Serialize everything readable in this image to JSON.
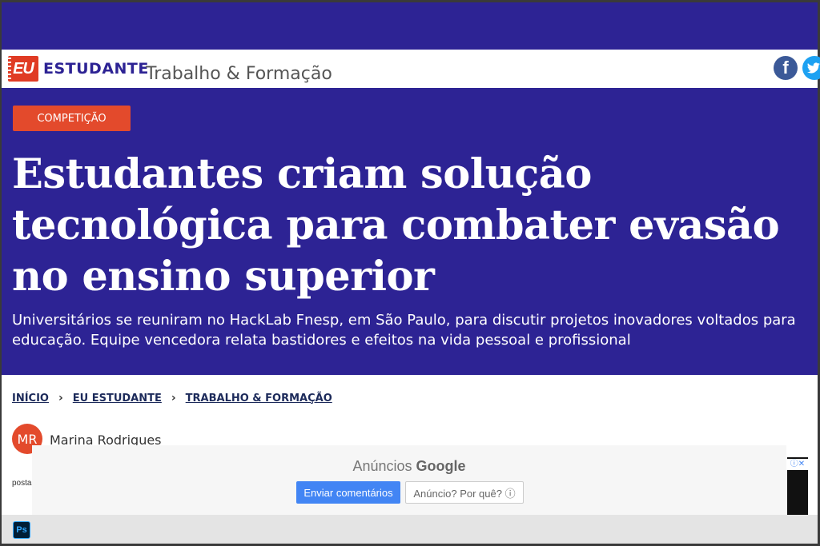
{
  "header": {
    "logo_badge": "EU",
    "logo_text": "ESTUDANTE",
    "section": "Trabalho & Formação",
    "social": {
      "facebook": "f",
      "twitter": "twitter-icon"
    }
  },
  "article": {
    "tag": "COMPETIÇÃO",
    "headline": "Estudantes criam solução tecnológica para combater evasão no ensino superior",
    "subhead": "Universitários se reuniram no HackLab Fnesp, em São Paulo, para discutir projetos inovadores voltados para educação. Equipe vencedora relata bastidores e efeitos na vida pessoal e profissional",
    "breadcrumb": [
      "INÍCIO",
      "EU ESTUDANTE",
      "TRABALHO & FORMAÇÃO"
    ],
    "author_initials": "MR",
    "author": "Marina Rodrigues",
    "posted_label": "posta"
  },
  "ad": {
    "title_prefix": "Anúncios",
    "title_brand": "Google",
    "feedback_button": "Enviar comentários",
    "why_button": "Anúncio? Por quê? ⓘ"
  },
  "taskbar": {
    "ps_label": "Ps"
  },
  "colors": {
    "brand_blue": "#2d2394",
    "accent_red": "#e34a2c"
  }
}
